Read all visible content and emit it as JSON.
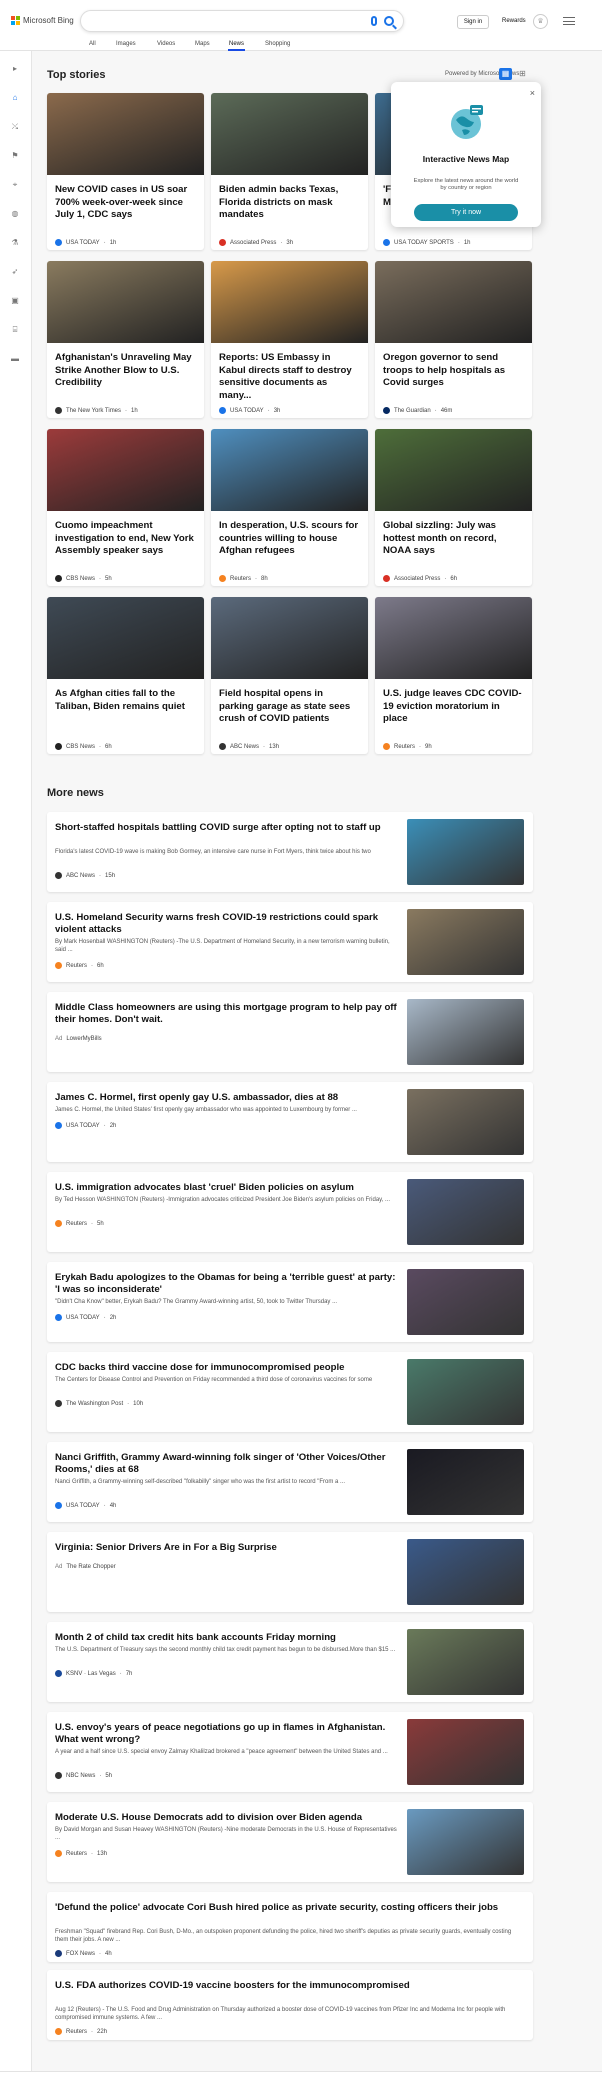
{
  "header": {
    "brand": "Microsoft Bing",
    "signin": "Sign in",
    "rewards": "Rewards"
  },
  "nav": {
    "tabs": [
      {
        "label": "All"
      },
      {
        "label": "Images"
      },
      {
        "label": "Videos"
      },
      {
        "label": "Maps"
      },
      {
        "label": "News"
      },
      {
        "label": "Shopping"
      }
    ],
    "active": "News"
  },
  "top_stories": {
    "heading": "Top stories",
    "powered_by": "Powered by Microsoft News",
    "cards": [
      {
        "title": "New COVID cases in US soar 700% week-over-week since July 1, CDC says",
        "source": "USA TODAY",
        "time": "1h",
        "src_color": "#1a73e8",
        "img": "#8b6a4c"
      },
      {
        "title": "Biden admin backs Texas, Florida districts on mask mandates",
        "source": "Associated Press",
        "time": "3h",
        "src_color": "#d93025",
        "img": "#5c6b58"
      },
      {
        "title": "'Field of Dreams' becomes MLB's first regulation game",
        "source": "USA TODAY SPORTS",
        "time": "1h",
        "src_color": "#1a73e8",
        "img": "#3d6b8e"
      },
      {
        "title": "Afghanistan's Unraveling May Strike Another Blow to U.S. Credibility",
        "source": "The New York Times",
        "time": "1h",
        "src_color": "#333333",
        "img": "#8a7b5f"
      },
      {
        "title": "Reports: US Embassy in Kabul directs staff to destroy sensitive documents as many...",
        "source": "USA TODAY",
        "time": "3h",
        "src_color": "#1a73e8",
        "img": "#d89a4a"
      },
      {
        "title": "Oregon governor to send troops to help hospitals as Covid surges",
        "source": "The Guardian",
        "time": "46m",
        "src_color": "#052962",
        "img": "#7a6d5c"
      },
      {
        "title": "Cuomo impeachment investigation to end, New York Assembly speaker says",
        "source": "CBS News",
        "time": "5h",
        "src_color": "#222222",
        "img": "#9c3b3b"
      },
      {
        "title": "In desperation, U.S. scours for countries willing to house Afghan refugees",
        "source": "Reuters",
        "time": "8h",
        "src_color": "#f58220",
        "img": "#4f8fbf"
      },
      {
        "title": "Global sizzling: July was hottest month on record, NOAA says",
        "source": "Associated Press",
        "time": "6h",
        "src_color": "#d93025",
        "img": "#4e6e3a"
      },
      {
        "title": "As Afghan cities fall to the Taliban, Biden remains quiet",
        "source": "CBS News",
        "time": "6h",
        "src_color": "#222222",
        "img": "#3f4a55"
      },
      {
        "title": "Field hospital opens in parking garage as state sees crush of COVID patients",
        "source": "ABC News",
        "time": "13h",
        "src_color": "#333333",
        "img": "#5b6a7c"
      },
      {
        "title": "U.S. judge leaves CDC COVID-19 eviction moratorium in place",
        "source": "Reuters",
        "time": "9h",
        "src_color": "#f58220",
        "img": "#7d7a8a"
      }
    ]
  },
  "popup": {
    "title": "Interactive News Map",
    "description": "Explore the latest news around the world by country or region",
    "button": "Try it now",
    "close": "×"
  },
  "more_news": {
    "heading": "More news",
    "items": [
      {
        "title": "Short-staffed hospitals battling COVID surge after opting not to staff up",
        "snippet": "Florida's latest COVID-19 wave is making Bob Gormey, an intensive care nurse in Fort Myers, think twice about his two",
        "source": "ABC News",
        "time": "15h",
        "src_color": "#333333",
        "img": "#3b8fb8"
      },
      {
        "title": "U.S. Homeland Security warns fresh COVID-19 restrictions could spark violent attacks",
        "snippet": "By Mark Hosenball WASHINGTON (Reuters) -The U.S. Department of Homeland Security, in a new terrorism warning bulletin, said ...",
        "source": "Reuters",
        "time": "6h",
        "src_color": "#f58220",
        "img": "#8a7a60"
      },
      {
        "title": "Middle Class homeowners are using this mortgage program to help pay off their homes. Don't wait.",
        "snippet": "",
        "source": "LowerMyBills",
        "time": "",
        "ad": "Ad",
        "src_color": "#999999",
        "img": "#a8b8c8"
      },
      {
        "title": "James C. Hormel, first openly gay U.S. ambassador, dies at 88",
        "snippet": "James C. Hormel, the United States' first openly gay ambassador who was appointed to Luxembourg by former ...",
        "source": "USA TODAY",
        "time": "2h",
        "src_color": "#1a73e8",
        "img": "#7a7060"
      },
      {
        "title": "U.S. immigration advocates blast 'cruel' Biden policies on asylum",
        "snippet": "By Ted Hesson WASHINGTON (Reuters) -Immigration advocates criticized President Joe Biden's asylum policies on Friday, ...",
        "source": "Reuters",
        "time": "5h",
        "src_color": "#f58220",
        "img": "#4a5a7a"
      },
      {
        "title": "Erykah Badu apologizes to the Obamas for being a 'terrible guest' at party: 'I was so inconsiderate'",
        "snippet": "\"Didn't Cha Know\" better, Erykah Badu? The Grammy Award-winning artist, 50, took to Twitter Thursday ...",
        "source": "USA TODAY",
        "time": "2h",
        "src_color": "#1a73e8",
        "img": "#5a4a60"
      },
      {
        "title": "CDC backs third vaccine dose for immunocompromised people",
        "snippet": "The Centers for Disease Control and Prevention on Friday recommended a third dose of coronavirus vaccines for some",
        "source": "The Washington Post",
        "time": "10h",
        "src_color": "#333333",
        "img": "#4a7a6a"
      },
      {
        "title": "Nanci Griffith, Grammy Award-winning folk singer of 'Other Voices/Other Rooms,' dies at 68",
        "snippet": "Nanci Griffith, a Grammy-winning self-described \"folkabilly\" singer who was the first artist to record \"From a ...",
        "source": "USA TODAY",
        "time": "4h",
        "src_color": "#1a73e8",
        "img": "#1a1a22"
      },
      {
        "title": "Virginia: Senior Drivers Are in For a Big Surprise",
        "snippet": "",
        "source": "The Rate Chopper",
        "time": "",
        "ad": "Ad",
        "src_color": "#999999",
        "img": "#3a5a8a"
      },
      {
        "title": "Month 2 of child tax credit hits bank accounts Friday morning",
        "snippet": "The U.S. Department of Treasury says the second monthly child tax credit payment has begun to be disbursed.More than $15 ...",
        "source": "KSNV · Las Vegas",
        "time": "7h",
        "src_color": "#1a4a9a",
        "img": "#6a7a5a"
      },
      {
        "title": "U.S. envoy's years of peace negotiations go up in flames in Afghanistan. What went wrong?",
        "snippet": "A year and a half since U.S. special envoy Zalmay Khalilzad brokered a \"peace agreement\" between the United States and ...",
        "source": "NBC News",
        "time": "5h",
        "src_color": "#333333",
        "img": "#8a3a3a"
      },
      {
        "title": "Moderate U.S. House Democrats add to division over Biden agenda",
        "snippet": "By David Morgan and Susan Heavey WASHINGTON (Reuters) -Nine moderate Democrats in the U.S. House of Representatives ...",
        "source": "Reuters",
        "time": "13h",
        "src_color": "#f58220",
        "img": "#6a9ac0"
      },
      {
        "title": "'Defund the police' advocate Cori Bush hired police as private security, costing officers their jobs",
        "snippet": "Freshman \"Squad\" firebrand Rep. Cori Bush, D-Mo., an outspoken proponent defunding the police, hired two sheriff's deputies as private security guards, eventually costing them their jobs. A new ...",
        "source": "FOX News",
        "time": "4h",
        "src_color": "#1a3a7a",
        "img": ""
      },
      {
        "title": "U.S. FDA authorizes COVID-19 vaccine boosters for the immunocompromised",
        "snippet": "Aug 12 (Reuters) - The U.S. Food and Drug Administration on Thursday authorized a booster dose of COVID-19 vaccines from Pfizer Inc and Moderna Inc for people with compromised immune systems. A few ...",
        "source": "Reuters",
        "time": "22h",
        "src_color": "#f58220",
        "img": ""
      }
    ]
  }
}
